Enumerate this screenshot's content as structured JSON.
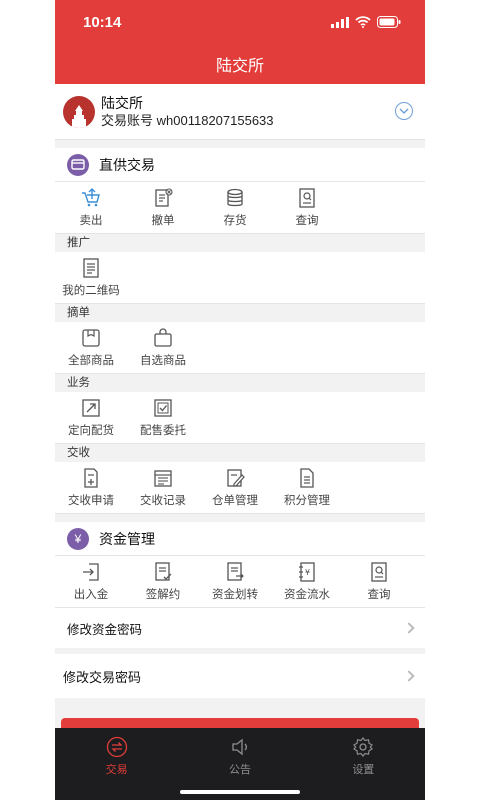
{
  "status": {
    "time": "10:14"
  },
  "header": {
    "title": "陆交所"
  },
  "account": {
    "name": "陆交所",
    "account_label": "交易账号",
    "account_no": "wh00118207155633"
  },
  "colors": {
    "brand_red": "#e23d3a",
    "purple_badge": "#7b5ea7",
    "tab_bg": "#1d1d1f"
  },
  "direct_trade": {
    "title": "直供交易",
    "items": [
      {
        "label": "卖出",
        "icon": "cart-upload-icon"
      },
      {
        "label": "撤单",
        "icon": "cancel-doc-icon"
      },
      {
        "label": "存货",
        "icon": "database-icon"
      },
      {
        "label": "查询",
        "icon": "search-doc-icon"
      }
    ]
  },
  "promo": {
    "title": "推广",
    "items": [
      {
        "label": "我的二维码",
        "icon": "qrcode-doc-icon"
      }
    ]
  },
  "pick": {
    "title": "摘单",
    "items": [
      {
        "label": "全部商品",
        "icon": "box-icon"
      },
      {
        "label": "自选商品",
        "icon": "bag-icon"
      }
    ]
  },
  "business": {
    "title": "业务",
    "items": [
      {
        "label": "定向配货",
        "icon": "expand-icon"
      },
      {
        "label": "配售委托",
        "icon": "check-box-icon"
      }
    ]
  },
  "delivery": {
    "title": "交收",
    "items": [
      {
        "label": "交收申请",
        "icon": "doc-plus-icon"
      },
      {
        "label": "交收记录",
        "icon": "records-icon"
      },
      {
        "label": "仓单管理",
        "icon": "edit-doc-icon"
      },
      {
        "label": "积分管理",
        "icon": "doc-lines-icon"
      }
    ]
  },
  "funds": {
    "title": "资金管理",
    "badge": "¥",
    "items": [
      {
        "label": "出入金",
        "icon": "login-icon"
      },
      {
        "label": "签解约",
        "icon": "sign-doc-icon"
      },
      {
        "label": "资金划转",
        "icon": "transfer-doc-icon"
      },
      {
        "label": "资金流水",
        "icon": "ledger-icon"
      },
      {
        "label": "查询",
        "icon": "search-doc-icon"
      }
    ],
    "change_pwd": "修改资金密码"
  },
  "trade_pwd": "修改交易密码",
  "tabs": [
    {
      "label": "交易",
      "icon": "exchange-icon",
      "active": true
    },
    {
      "label": "公告",
      "icon": "speaker-icon",
      "active": false
    },
    {
      "label": "设置",
      "icon": "gear-icon",
      "active": false
    }
  ]
}
